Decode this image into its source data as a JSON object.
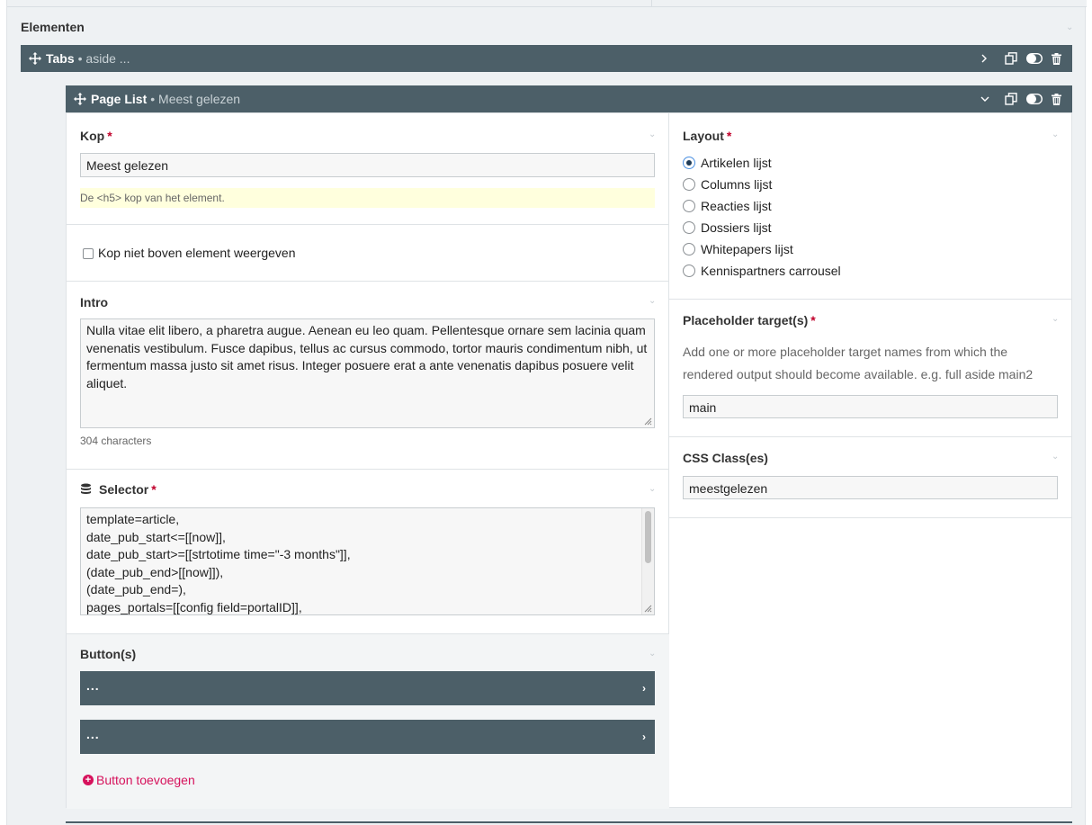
{
  "section_title": "Elementen",
  "tabs_bar": {
    "title": "Tabs",
    "subtitle": "• aside ..."
  },
  "pagelist_bar": {
    "title": "Page List",
    "subtitle": "• Meest gelezen"
  },
  "kop": {
    "label": "Kop",
    "required_mark": "*",
    "value": "Meest gelezen",
    "help": "De <h5> kop van het element."
  },
  "hide_heading": {
    "label": "Kop niet boven element weergeven",
    "checked": false
  },
  "intro": {
    "label": "Intro",
    "value": "Nulla vitae elit libero, a pharetra augue. Aenean eu leo quam. Pellentesque ornare sem lacinia quam venenatis vestibulum. Fusce dapibus, tellus ac cursus commodo, tortor mauris condimentum nibh, ut fermentum massa justo sit amet risus. Integer posuere erat a ante venenatis dapibus posuere velit aliquet.",
    "count": "304 characters"
  },
  "selector": {
    "label": "Selector",
    "required_mark": "*",
    "lines": [
      "template=article,",
      "date_pub_start<=[[now]],",
      "date_pub_start>=[[strtotime time=\"-3 months\"]],",
      "(date_pub_end>[[now]]),",
      "(date_pub_end=),",
      "pages_portals=[[config field=portalID]],"
    ]
  },
  "buttons": {
    "label": "Button(s)",
    "items": [
      {
        "label": "..."
      },
      {
        "label": "..."
      }
    ],
    "add_label": "Button toevoegen"
  },
  "layout": {
    "label": "Layout",
    "required_mark": "*",
    "options": [
      {
        "label": "Artikelen lijst",
        "selected": true
      },
      {
        "label": "Columns lijst",
        "selected": false
      },
      {
        "label": "Reacties lijst",
        "selected": false
      },
      {
        "label": "Dossiers lijst",
        "selected": false
      },
      {
        "label": "Whitepapers lijst",
        "selected": false
      },
      {
        "label": "Kennispartners carrousel",
        "selected": false
      }
    ]
  },
  "placeholder": {
    "label": "Placeholder target(s)",
    "required_mark": "*",
    "help_line1": "Add one or more placeholder target names from which the",
    "help_line2": "rendered output should become available. e.g. full aside main2",
    "value": "main"
  },
  "css_class": {
    "label": "CSS Class(es)",
    "value": "meestgelezen"
  },
  "colors": {
    "bar": "#4c5f68",
    "required": "#c0002a",
    "add": "#d6125c",
    "help_bg": "#ffffdd"
  },
  "icons": [
    "move-icon",
    "chevron-right-icon",
    "chevron-down-icon",
    "copy-icon",
    "toggle-icon",
    "trash-icon",
    "database-icon",
    "plus-circle-icon"
  ]
}
